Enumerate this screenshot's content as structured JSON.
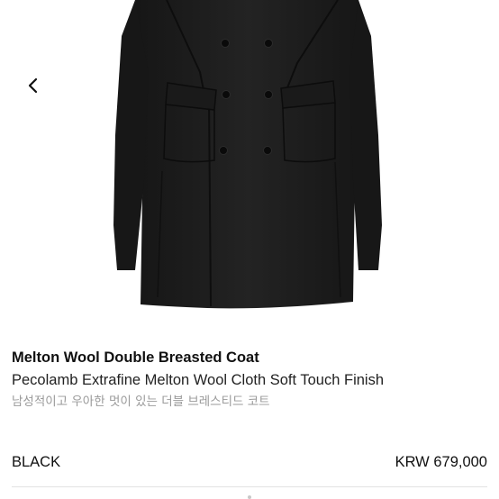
{
  "gallery": {
    "prev_icon": "chevron-left-icon",
    "image_subject": "black double-breasted coat"
  },
  "product": {
    "name": "Melton Wool Double Breasted Coat",
    "subtitle": "Pecolamb Extrafine Melton Wool Cloth Soft Touch Finish",
    "korean_description": "남성적이고 우아한 멋이 있는 더블 브레스티드 코트"
  },
  "option": {
    "color": "BLACK",
    "price": "KRW 679,000"
  },
  "colors": {
    "coat": "#1e1e1e",
    "text_primary": "#111111",
    "text_muted": "#9a9a9a",
    "divider": "#e2e2e2"
  }
}
